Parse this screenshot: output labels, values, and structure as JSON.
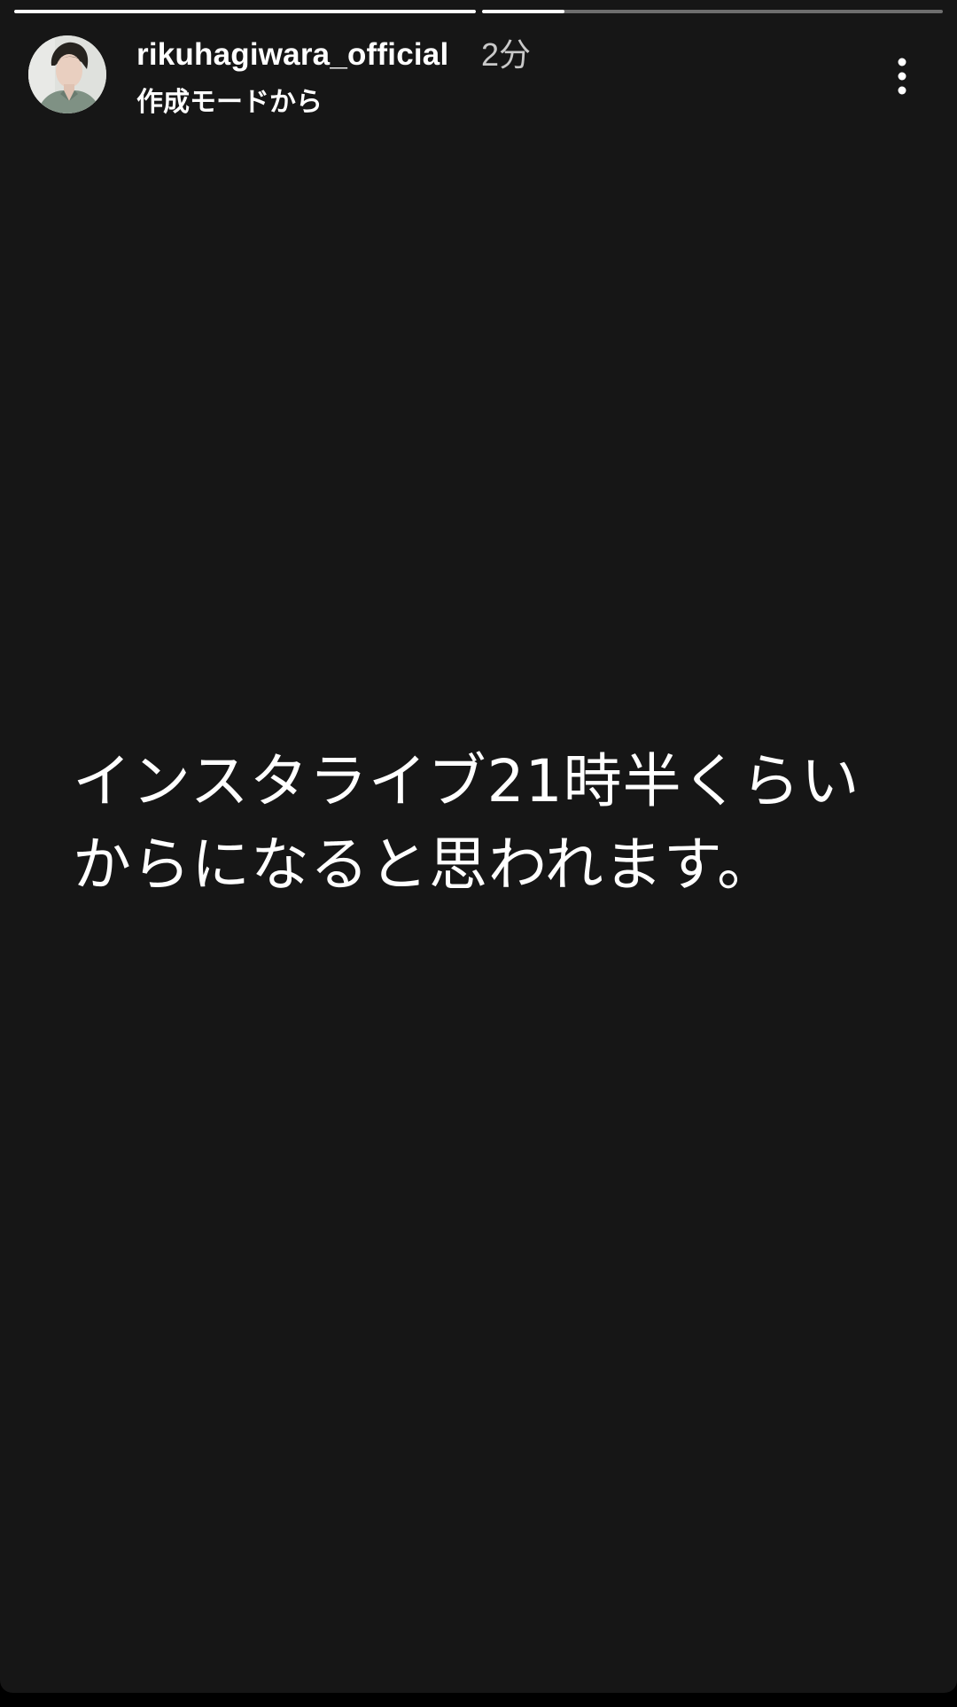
{
  "story": {
    "progress": [
      {
        "filled": 1.0
      },
      {
        "filled": 0.18
      }
    ],
    "author": {
      "username": "rikuhagiwara_official",
      "posted_ago": "2分",
      "subtitle": "作成モードから",
      "avatar_icon": "profile-photo"
    },
    "menu_icon": "more-vertical-icon",
    "caption": {
      "line1": "インスタライブ21時半くらい",
      "line2": "からになると思われます。"
    }
  },
  "colors": {
    "background": "#161616",
    "progress_track": "#5e5e5e",
    "progress_fill": "#ffffff",
    "timestamp": "#c9c9c9"
  }
}
